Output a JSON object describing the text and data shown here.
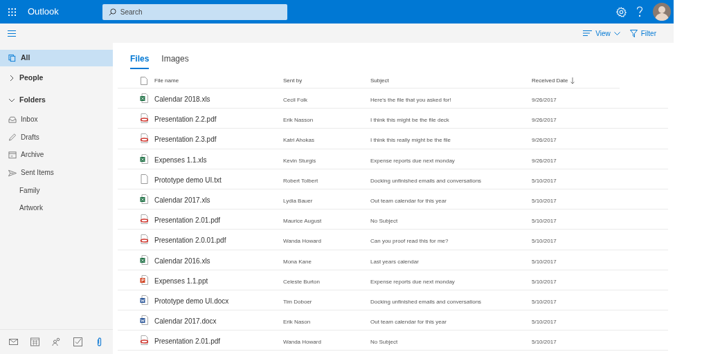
{
  "app": {
    "title": "Outlook"
  },
  "search": {
    "placeholder": "Search"
  },
  "toolbar": {
    "buttons": [
      {
        "kind": "view",
        "label": "View"
      },
      {
        "kind": "filter",
        "label": "Filter"
      }
    ]
  },
  "sidebar": {
    "items": [
      {
        "kind": "all",
        "label": "All",
        "selected": true
      },
      {
        "kind": "group",
        "label": "People",
        "expanded": false,
        "selected": false
      },
      {
        "kind": "group",
        "label": "Folders",
        "expanded": true,
        "selected": false,
        "children": [
          {
            "kind": "inbox",
            "label": "Inbox",
            "selected": false
          },
          {
            "kind": "drafts",
            "label": "Drafts",
            "selected": false
          },
          {
            "kind": "archive",
            "label": "Archive",
            "selected": false
          },
          {
            "kind": "sent",
            "label": "Sent Items",
            "selected": false
          },
          {
            "kind": "plain",
            "label": "Family",
            "selected": false
          },
          {
            "kind": "plain",
            "label": "Artwork",
            "selected": false
          }
        ]
      }
    ]
  },
  "bottom_nav": [
    {
      "kind": "mail",
      "selected": false
    },
    {
      "kind": "calendar",
      "selected": false
    },
    {
      "kind": "people",
      "selected": false
    },
    {
      "kind": "tasks",
      "selected": false
    },
    {
      "kind": "attachment",
      "selected": true
    }
  ],
  "tabs": [
    {
      "label": "Files",
      "selected": true
    },
    {
      "label": "Images",
      "selected": false
    }
  ],
  "table": {
    "columns": [
      {
        "label": "File name"
      },
      {
        "label": "Sent by"
      },
      {
        "label": "Subject"
      },
      {
        "label": "Received Date",
        "sorted_descending": true
      }
    ],
    "rows": [
      {
        "kind": "xls",
        "file_name": "Calendar 2018.xls",
        "sent_by": "Cecil Folk",
        "subject": "Here's the file that you asked for!",
        "received_date": "9/26/2017"
      },
      {
        "kind": "pdf",
        "file_name": "Presentation 2.2.pdf",
        "sent_by": "Erik Nasson",
        "subject": "I think this might be the file deck",
        "received_date": "9/26/2017"
      },
      {
        "kind": "pdf",
        "file_name": "Presentation 2.3.pdf",
        "sent_by": "Katri Ahokas",
        "subject": "I think this really might be the file",
        "received_date": "9/26/2017"
      },
      {
        "kind": "xls",
        "file_name": "Expenses 1.1.xls",
        "sent_by": "Kevin Sturgis",
        "subject": "Expense reports due next monday",
        "received_date": "9/26/2017"
      },
      {
        "kind": "txt",
        "file_name": "Prototype demo UI.txt",
        "sent_by": "Robert Tolbert",
        "subject": "Docking unfinished emails and conversations",
        "received_date": "5/10/2017"
      },
      {
        "kind": "xls",
        "file_name": "Calendar 2017.xls",
        "sent_by": "Lydia Bauer",
        "subject": "Out team calendar for this year",
        "received_date": "5/10/2017"
      },
      {
        "kind": "pdf",
        "file_name": "Presentation 2.01.pdf",
        "sent_by": "Maurice August",
        "subject": "No Subject",
        "received_date": "5/10/2017"
      },
      {
        "kind": "pdf",
        "file_name": "Presentation 2.0.01.pdf",
        "sent_by": "Wanda Howard",
        "subject": "Can you proof read this for me?",
        "received_date": "5/10/2017"
      },
      {
        "kind": "xls",
        "file_name": "Calendar 2016.xls",
        "sent_by": "Mona Kane",
        "subject": "Last years calendar",
        "received_date": "5/10/2017"
      },
      {
        "kind": "ppt",
        "file_name": "Expenses 1.1.ppt",
        "sent_by": "Celeste Burton",
        "subject": "Expense reports due next monday",
        "received_date": "5/10/2017"
      },
      {
        "kind": "docx",
        "file_name": "Prototype demo UI.docx",
        "sent_by": "Tim Doboer",
        "subject": "Docking unfinished emails and conversations",
        "received_date": "5/10/2017"
      },
      {
        "kind": "docx",
        "file_name": "Calendar 2017.docx",
        "sent_by": "Erik Nason",
        "subject": "Out team calendar for this year",
        "received_date": "5/10/2017"
      },
      {
        "kind": "pdf",
        "file_name": "Presentation 2.01.pdf",
        "sent_by": "Wanda Howard",
        "subject": "No Subject",
        "received_date": "5/10/2017"
      }
    ]
  }
}
